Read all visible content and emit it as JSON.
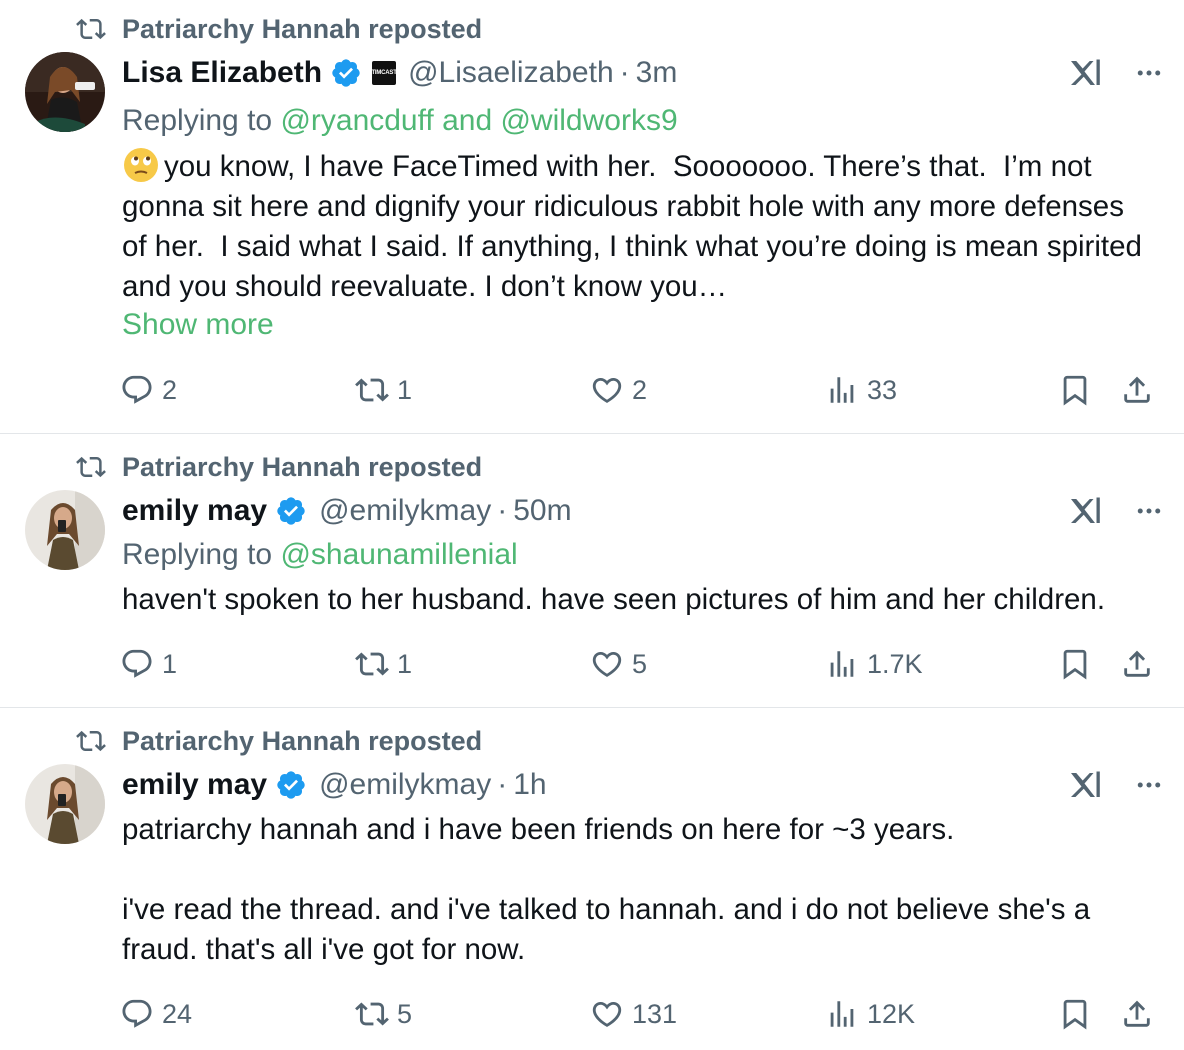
{
  "repost_label": "Patriarchy Hannah reposted",
  "colors": {
    "accent_link": "#4fb774",
    "secondary_text": "#536471",
    "verified": "#1d9bf0"
  },
  "posts": [
    {
      "name": "Lisa Elizabeth",
      "org_badge": "TIMCAST",
      "handle": "@Lisaelizabeth",
      "dot": "·",
      "time": "3m",
      "replying_prefix": "Replying to",
      "replying_to": "@ryancduff and @wildworks9",
      "emoji": "🙄",
      "text": "you know, I have FaceTimed with her.  Sooooooo. There’s that.  I’m not gonna sit here and dignify your ridiculous rabbit hole with any more defenses of her.  I said what I said. If anything, I think what you’re doing is mean spirited and you should reevaluate. I don’t know you…",
      "show_more": "Show more",
      "replies": "2",
      "reposts": "1",
      "likes": "2",
      "views": "33"
    },
    {
      "name": "emily may",
      "handle": "@emilykmay",
      "dot": "·",
      "time": "50m",
      "replying_prefix": "Replying to",
      "replying_to": "@shaunamillenial",
      "text": "haven't spoken to her husband. have seen pictures of him and her children.",
      "replies": "1",
      "reposts": "1",
      "likes": "5",
      "views": "1.7K"
    },
    {
      "name": "emily may",
      "handle": "@emilykmay",
      "dot": "·",
      "time": "1h",
      "text": "patriarchy hannah and i have been friends on here for ~3 years.\n\ni've read the thread. and i've talked to hannah. and i do not believe she's a fraud. that's all i've got for now.",
      "replies": "24",
      "reposts": "5",
      "likes": "131",
      "views": "12K"
    }
  ]
}
